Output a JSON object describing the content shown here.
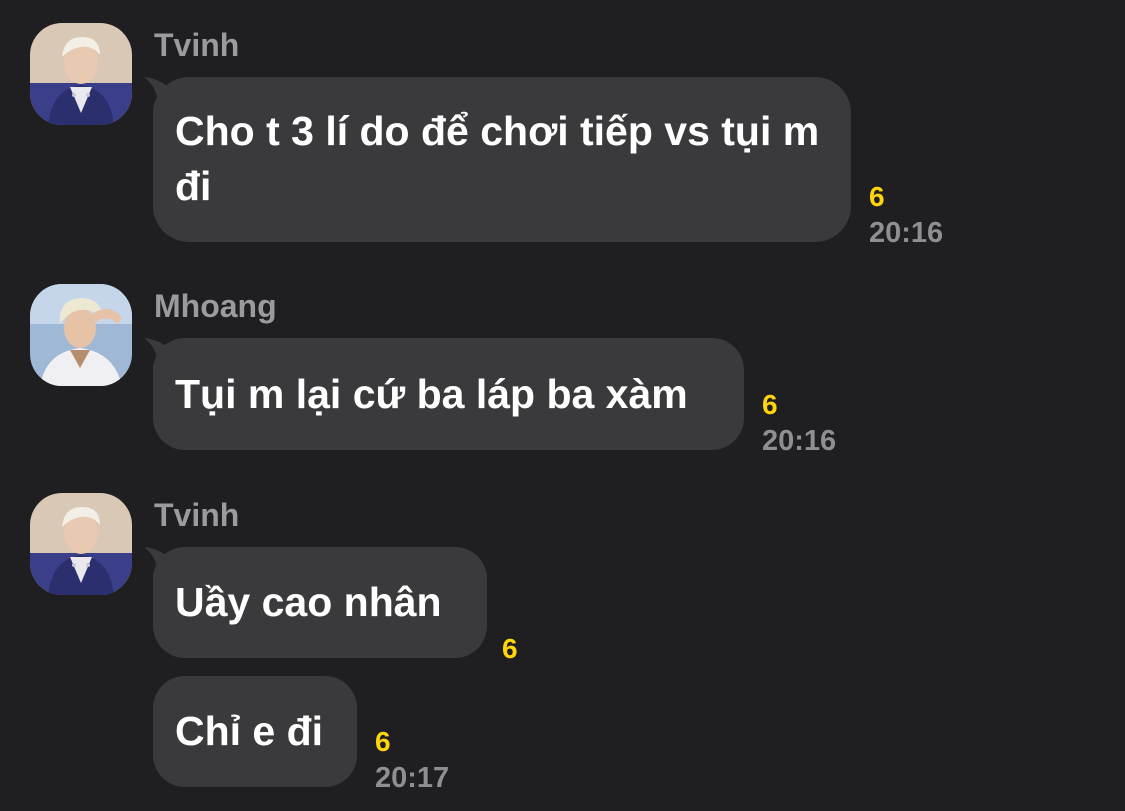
{
  "messages": [
    {
      "sender": "Tvinh",
      "avatar_icon": "user-avatar-tvinh",
      "bubbles": [
        {
          "text": "Cho t 3 lí do để chơi tiếp vs tụi m đi",
          "count": "6",
          "time": "20:16"
        }
      ]
    },
    {
      "sender": "Mhoang",
      "avatar_icon": "user-avatar-mhoang",
      "bubbles": [
        {
          "text": "Tụi m lại cứ ba láp ba xàm",
          "count": "6",
          "time": "20:16"
        }
      ]
    },
    {
      "sender": "Tvinh",
      "avatar_icon": "user-avatar-tvinh",
      "bubbles": [
        {
          "text": "Uầy cao nhân",
          "count": "6",
          "time": ""
        },
        {
          "text": "Chỉ e đi",
          "count": "6",
          "time": "20:17"
        }
      ]
    }
  ],
  "colors": {
    "background": "#1f1f21",
    "bubble": "#3a3a3d",
    "sender": "#9a9a9f",
    "count": "#ffd60a",
    "time": "#8e8e93"
  }
}
